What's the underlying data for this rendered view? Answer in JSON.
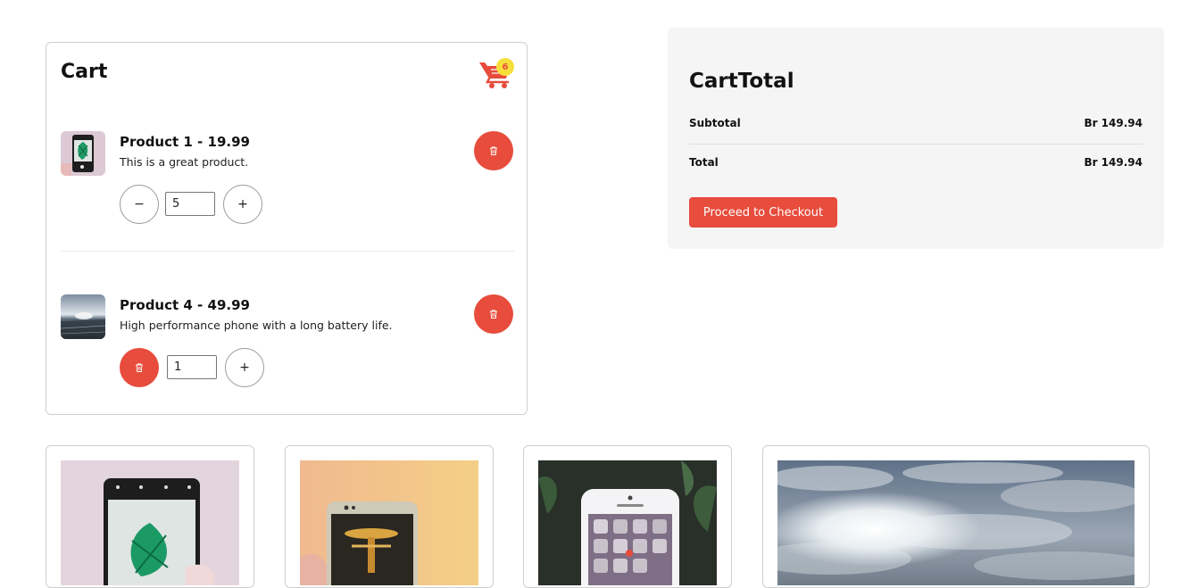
{
  "cart": {
    "title": "Cart",
    "badge_count": "6",
    "items": [
      {
        "name": "Product 1 - 19.99",
        "description": "This is a great product.",
        "quantity": "5",
        "decrement_label": "−",
        "increment_label": "+"
      },
      {
        "name": "Product 4 - 49.99",
        "description": "High performance phone with a long battery life.",
        "quantity": "1",
        "increment_label": "+"
      }
    ]
  },
  "cart_total": {
    "title": "CartTotal",
    "subtotal_label": "Subtotal",
    "subtotal_value": "Br 149.94",
    "total_label": "Total",
    "total_value": "Br 149.94",
    "checkout_label": "Proceed to Checkout"
  },
  "colors": {
    "accent": "#e74c3c",
    "badge": "#f6df3a",
    "panel_bg": "#f5f5f5"
  },
  "icons": [
    "shopping-cart-icon",
    "trash-icon"
  ]
}
